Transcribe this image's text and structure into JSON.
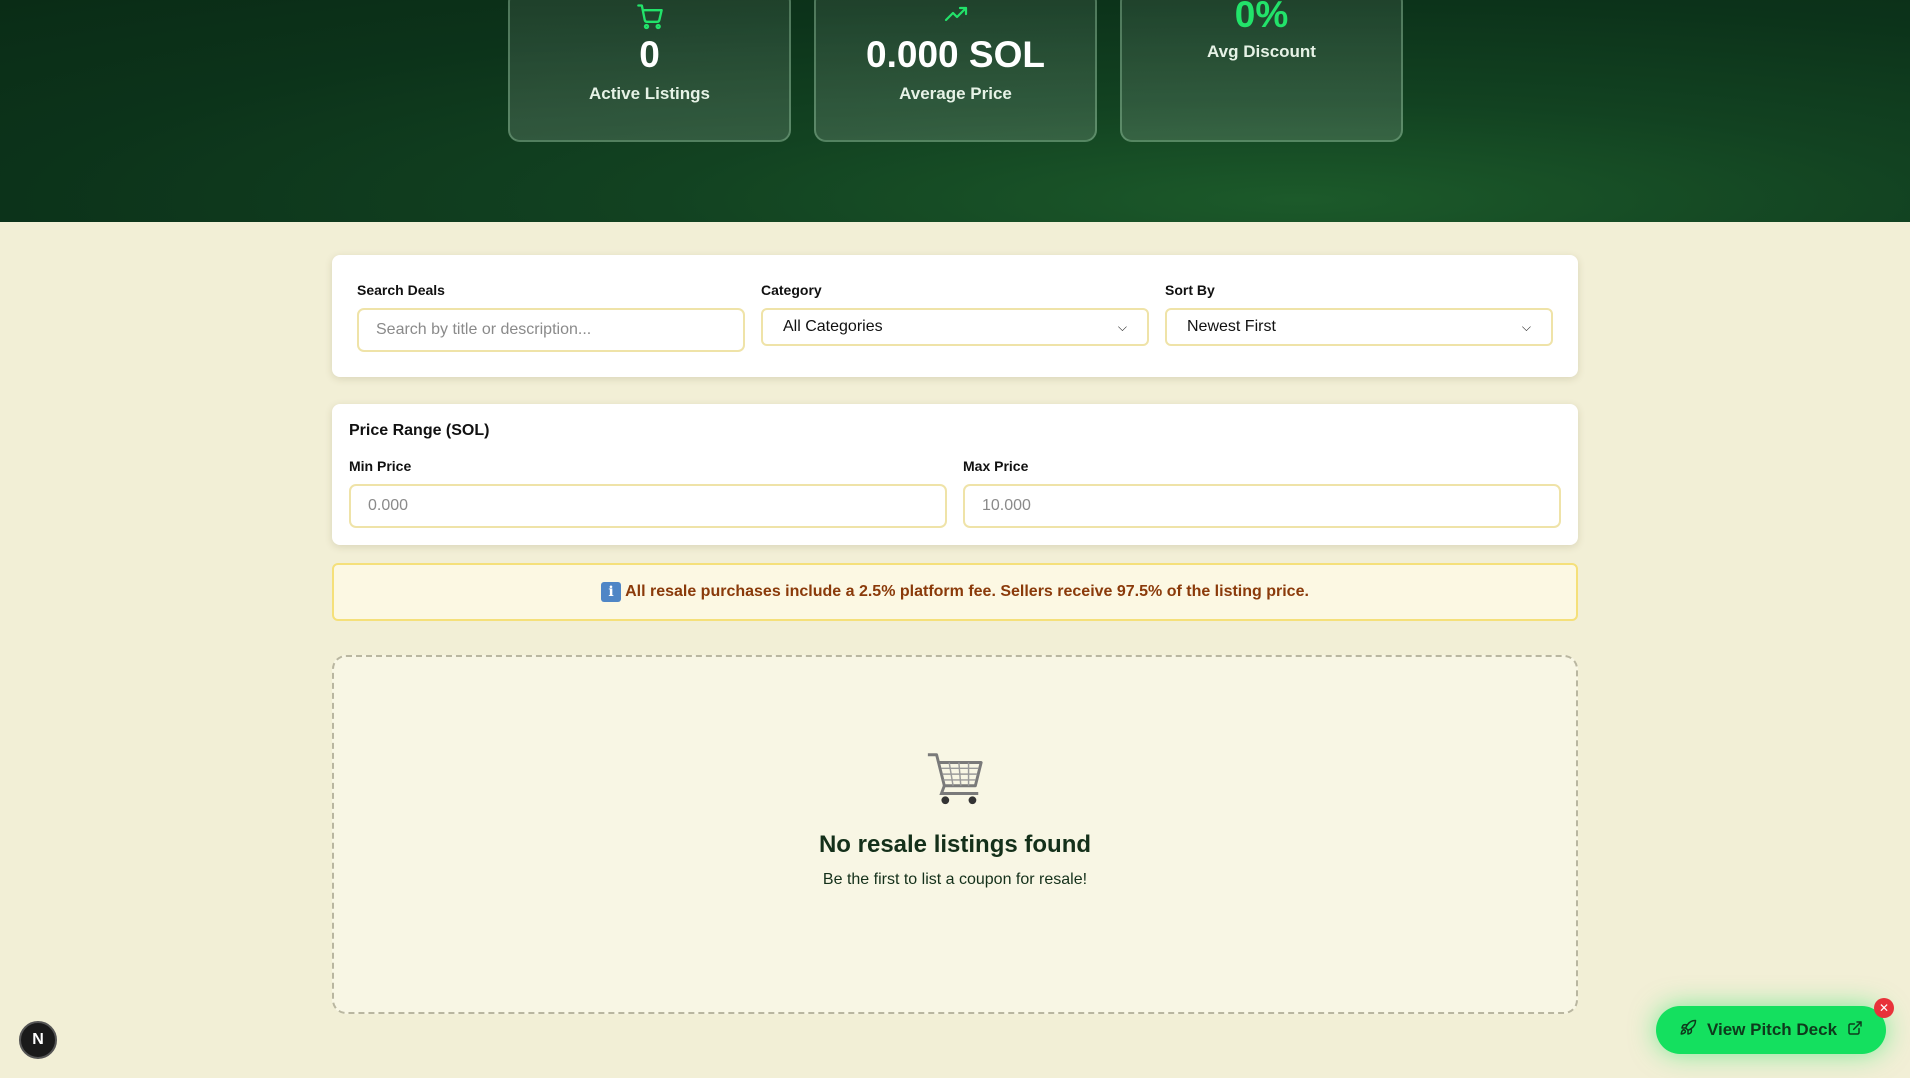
{
  "stats": {
    "active_listings": {
      "value": "0",
      "label": "Active Listings",
      "icon": "cart-icon"
    },
    "average_price": {
      "value": "0.000 SOL",
      "label": "Average Price",
      "icon": "trending-up-icon"
    },
    "avg_discount": {
      "value": "0%",
      "label": "Avg Discount"
    }
  },
  "filters": {
    "search_label": "Search Deals",
    "search_placeholder": "Search by title or description...",
    "search_value": "",
    "category_label": "Category",
    "category_selected": "All Categories",
    "sort_label": "Sort By",
    "sort_selected": "Newest First"
  },
  "price_range": {
    "title": "Price Range (SOL)",
    "min_label": "Min Price",
    "min_placeholder": "0.000",
    "max_label": "Max Price",
    "max_placeholder": "10.000"
  },
  "notice": {
    "icon": "info-icon",
    "text": "All resale purchases include a 2.5% platform fee. Sellers receive 97.5% of the listing price."
  },
  "empty_state": {
    "icon": "shopping-cart-emoji",
    "title": "No resale listings found",
    "subtitle": "Be the first to list a coupon for resale!"
  },
  "dev_badge": {
    "letter": "N"
  },
  "pitch_button": {
    "label": "View Pitch Deck",
    "close_glyph": "✕"
  },
  "colors": {
    "accent_green": "#22e36a",
    "hero_bg": "#0c331a",
    "page_bg": "#f2efd6",
    "notice_text": "#8a3a0a"
  }
}
